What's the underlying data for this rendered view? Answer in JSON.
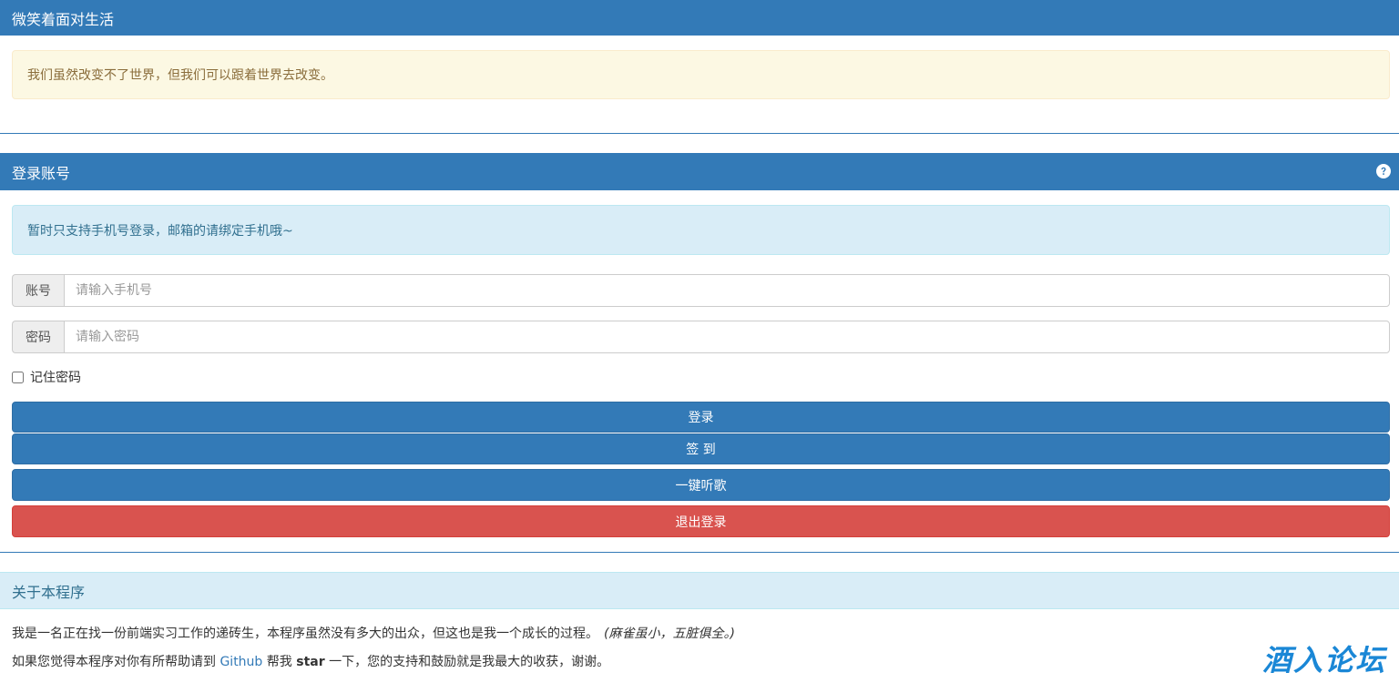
{
  "motto": {
    "title": "微笑着面对生活",
    "message": "我们虽然改变不了世界，但我们可以跟着世界去改变。"
  },
  "login": {
    "title": "登录账号",
    "help_icon": "question-circle-icon",
    "notice": "暂时只支持手机号登录，邮箱的请绑定手机哦~",
    "account_label": "账号",
    "account_placeholder": "请输入手机号",
    "account_value": "",
    "password_label": "密码",
    "password_placeholder": "请输入密码",
    "password_value": "",
    "remember_label": "记住密码",
    "remember_checked": false,
    "buttons": {
      "login": "登录",
      "signin": "签 到",
      "listen": "一键听歌",
      "logout": "退出登录"
    }
  },
  "about": {
    "title": "关于本程序",
    "line1_text": "我是一名正在找一份前端实习工作的递砖生，本程序虽然没有多大的出众，但这也是我一个成长的过程。",
    "line1_quote": "(麻雀虽小，五脏俱全。)",
    "line2_prefix": "如果您觉得本程序对你有所帮助请到 ",
    "line2_link": "Github",
    "line2_mid": " 帮我 ",
    "line2_strong": "star",
    "line2_suffix": " 一下，您的支持和鼓励就是我最大的收获，谢谢。"
  },
  "watermark": "酒入论坛",
  "colors": {
    "primary": "#337ab7",
    "danger": "#d9534f",
    "warning_bg": "#fcf8e3",
    "info_bg": "#d9edf7"
  }
}
